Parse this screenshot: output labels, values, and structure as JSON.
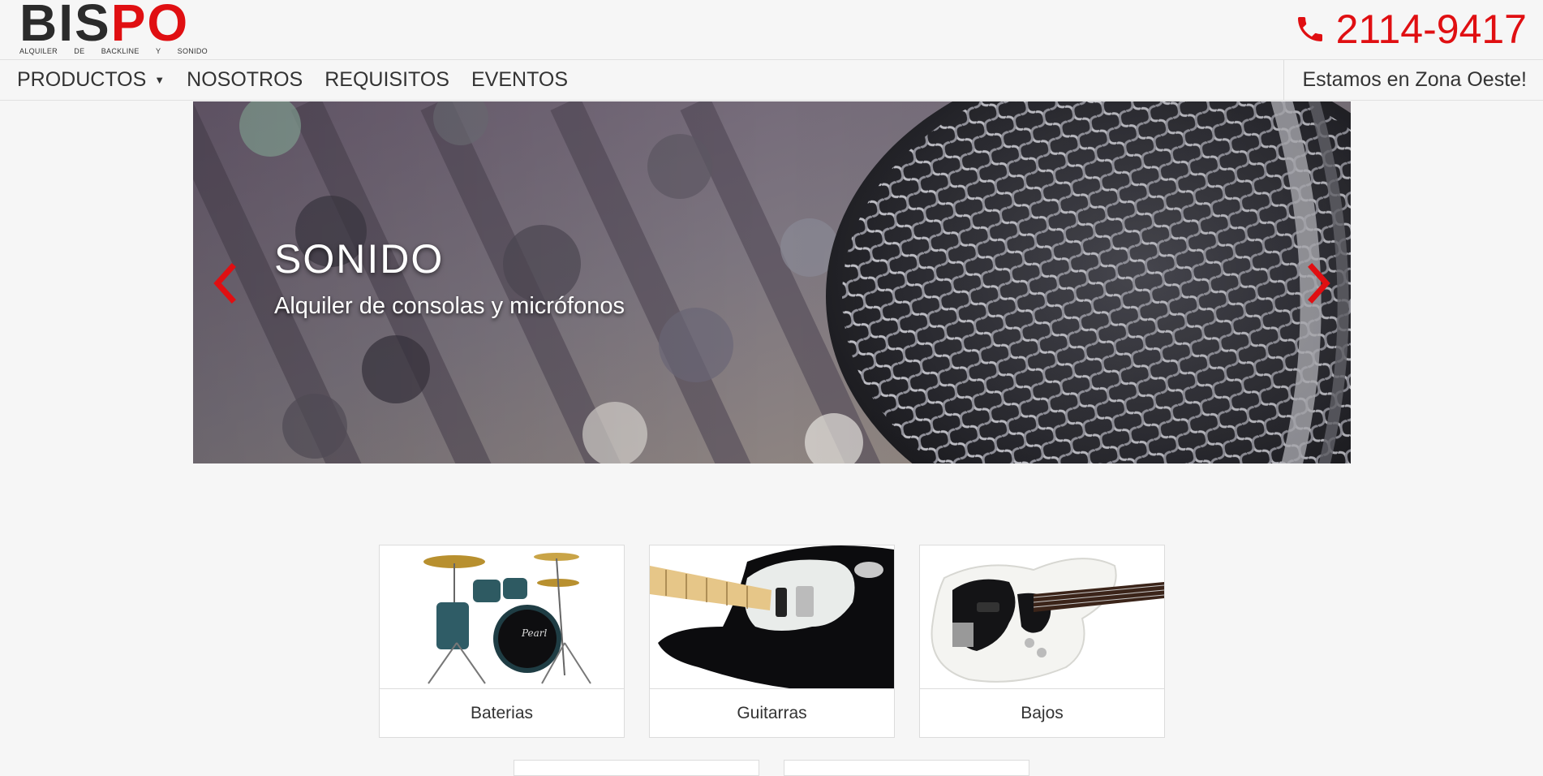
{
  "header": {
    "logo": {
      "part_dark": "BIS",
      "part_red": "PO",
      "tagline": [
        "ALQUILER",
        "DE",
        "BACKLINE",
        "Y",
        "SONIDO"
      ]
    },
    "phone": {
      "icon": "phone-icon",
      "number": "2114-9417"
    }
  },
  "nav": {
    "items": [
      {
        "label": "PRODUCTOS",
        "has_dropdown": true,
        "caret": "▼"
      },
      {
        "label": "NOSOTROS"
      },
      {
        "label": "REQUISITOS"
      },
      {
        "label": "EVENTOS"
      }
    ],
    "zone_text": "Estamos en Zona Oeste!"
  },
  "carousel": {
    "title": "SONIDO",
    "subtitle": "Alquiler de consolas y micrófonos",
    "prev_icon": "chevron-left-icon",
    "next_icon": "chevron-right-icon",
    "arrow_color": "#e00f12"
  },
  "categories": [
    {
      "label": "Baterias",
      "image": "drum-kit-image"
    },
    {
      "label": "Guitarras",
      "image": "electric-guitar-image"
    },
    {
      "label": "Bajos",
      "image": "bass-guitar-image"
    }
  ],
  "colors": {
    "brand_red": "#e00f12",
    "brand_dark": "#2b2b2b",
    "page_bg": "#f6f6f6"
  }
}
